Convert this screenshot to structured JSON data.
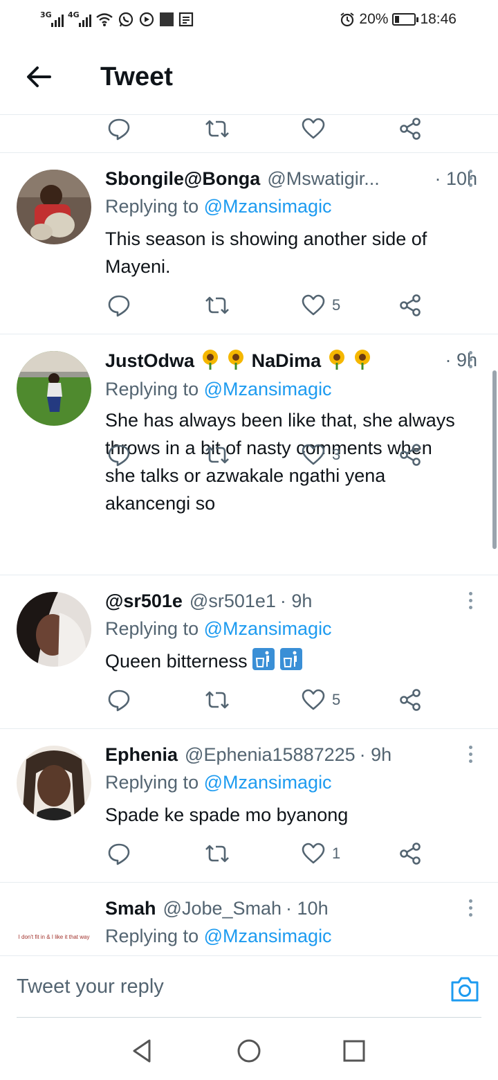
{
  "status_bar": {
    "network1": "3G",
    "network2": "4G",
    "battery_percent": "20%",
    "battery_level": 0.2,
    "time": "18:46",
    "icons": [
      "signal-icon",
      "signal-icon",
      "wifi-icon",
      "whatsapp-icon",
      "music-icon",
      "square-icon",
      "news-icon",
      "alarm-icon",
      "battery-icon"
    ]
  },
  "header": {
    "title": "Tweet",
    "back_icon": "arrow-left-icon"
  },
  "top_actions": {
    "reply_count": "",
    "retweet_count": "",
    "like_count": ""
  },
  "tweets": [
    {
      "name": "Sbongile@Bonga",
      "handle": "@Mswatigir...",
      "time": "· 10h",
      "replying_label": "Replying to",
      "replying_to": "@Mzansimagic",
      "text": "This season is showing another side of Mayeni.",
      "reply_count": "",
      "retweet_count": "",
      "like_count": "5"
    },
    {
      "name_part1": "JustOdwa",
      "name_part2": "NaDima",
      "name_emoji": "sunflower-icon",
      "handle": "",
      "time": "· 9h",
      "replying_label": "Replying to",
      "replying_to": "@Mzansimagic",
      "text": "She has always been like that, she always throws in a bit of nasty comments when she talks or azwakale ngathi yena akancengi so",
      "reply_count": "",
      "retweet_count": "",
      "like_count": "3"
    },
    {
      "name": "@sr501e",
      "handle": "@sr501e1",
      "time": "· 9h",
      "replying_label": "Replying to",
      "replying_to": "@Mzansimagic",
      "text": "Queen bitterness",
      "text_emoji": "litter-bin-icon",
      "reply_count": "",
      "retweet_count": "",
      "like_count": "5"
    },
    {
      "name": "Ephenia",
      "handle": "@Ephenia15887225",
      "time": "· 9h",
      "replying_label": "Replying to",
      "replying_to": "@Mzansimagic",
      "text": "Spade ke spade mo byanong",
      "reply_count": "",
      "retweet_count": "",
      "like_count": "1"
    },
    {
      "name": "Smah",
      "handle": "@Jobe_Smah",
      "time": "· 10h",
      "replying_label": "Replying to",
      "replying_to": "@Mzansimagic",
      "avatar_text": "I don't fit in & I like it that way"
    }
  ],
  "reply_bar": {
    "placeholder": "Tweet your reply",
    "camera_icon": "camera-icon"
  },
  "nav_bar": {
    "icons": [
      "back-triangle-icon",
      "home-circle-icon",
      "recents-square-icon"
    ]
  },
  "colors": {
    "accent": "#1d9bf0",
    "text_primary": "#0f1419",
    "text_secondary": "#536471",
    "divider": "#e6ecf0"
  }
}
